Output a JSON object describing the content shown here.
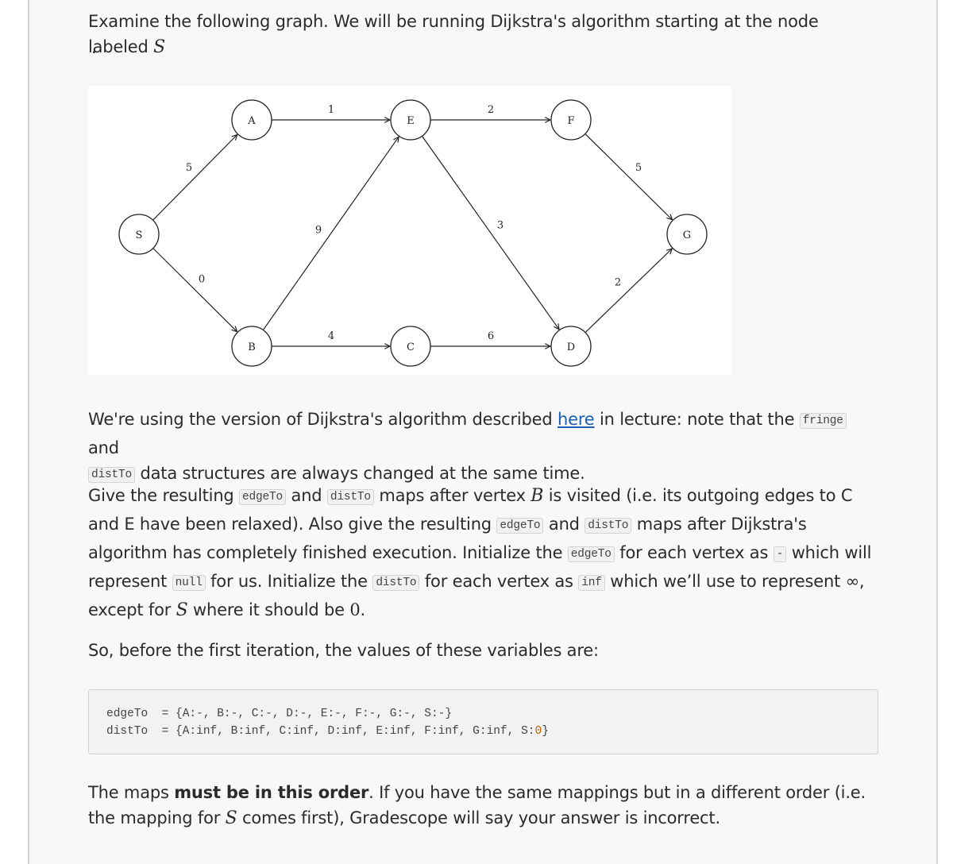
{
  "intro": {
    "text": "Examine the following graph. We will be running Dijkstra's algorithm starting at the node labeled",
    "math_symbol": "S",
    "trailing": "."
  },
  "graph": {
    "nodes": [
      {
        "id": "S",
        "label": "S"
      },
      {
        "id": "A",
        "label": "A"
      },
      {
        "id": "B",
        "label": "B"
      },
      {
        "id": "E",
        "label": "E"
      },
      {
        "id": "C",
        "label": "C"
      },
      {
        "id": "F",
        "label": "F"
      },
      {
        "id": "D",
        "label": "D"
      },
      {
        "id": "G",
        "label": "G"
      }
    ],
    "edges": [
      {
        "from": "S",
        "to": "A",
        "weight": "5"
      },
      {
        "from": "S",
        "to": "B",
        "weight": "0"
      },
      {
        "from": "A",
        "to": "E",
        "weight": "1"
      },
      {
        "from": "B",
        "to": "E",
        "weight": "9"
      },
      {
        "from": "B",
        "to": "C",
        "weight": "4"
      },
      {
        "from": "E",
        "to": "F",
        "weight": "2"
      },
      {
        "from": "E",
        "to": "D",
        "weight": "3"
      },
      {
        "from": "C",
        "to": "D",
        "weight": "6"
      },
      {
        "from": "F",
        "to": "G",
        "weight": "5"
      },
      {
        "from": "D",
        "to": "G",
        "weight": "2"
      }
    ]
  },
  "version_paragraph": {
    "part1": "We're using the version of Dijkstra's algorithm described ",
    "link_text": "here",
    "part2": " in lecture: note that the ",
    "code_fringe": "fringe",
    "part3": " and ",
    "code_distTo": "distTo",
    "part4": " data structures are always changed at the same time."
  },
  "question_paragraph": {
    "t1": "Give the resulting ",
    "c1": "edgeTo",
    "t2": " and ",
    "c2": "distTo",
    "t3": " maps after vertex ",
    "m1": "B",
    "t4": " is visited (i.e. its outgoing edges to C and E have been relaxed). Also give the resulting ",
    "c3": "edgeTo",
    "t5": " and ",
    "c4": "distTo",
    "t6": " maps after Dijkstra's algorithm has completely finished execution. Initialize the ",
    "c5": "edgeTo",
    "t7": " for each vertex as ",
    "c6": "-",
    "t8": " which will represent ",
    "c7": "null",
    "t9": " for us. Initialize the ",
    "c8": "distTo",
    "t10": " for each vertex as ",
    "c9": "inf",
    "t11": " which we’ll use to represent ∞, except for ",
    "m2": "S",
    "t12": " where it should be ",
    "m3": "0",
    "t13": "."
  },
  "before_text": "So, before the first iteration, the values of these variables are:",
  "code_block": {
    "line1": "edgeTo  = {A:-, B:-, C:-, D:-, E:-, F:-, G:-, S:-}",
    "line2_prefix": "distTo  = {A:inf, B:inf, C:inf, D:inf, E:inf, F:inf, G:inf, S:",
    "line2_value": "0",
    "line2_suffix": "}"
  },
  "order_paragraph": {
    "t1": "The maps ",
    "bold": "must be in this order",
    "t2": ". If you have the same mappings but in a different order  (i.e. the mapping for ",
    "m1": "S",
    "t3": " comes first), Gradescope will say your answer is incorrect."
  }
}
